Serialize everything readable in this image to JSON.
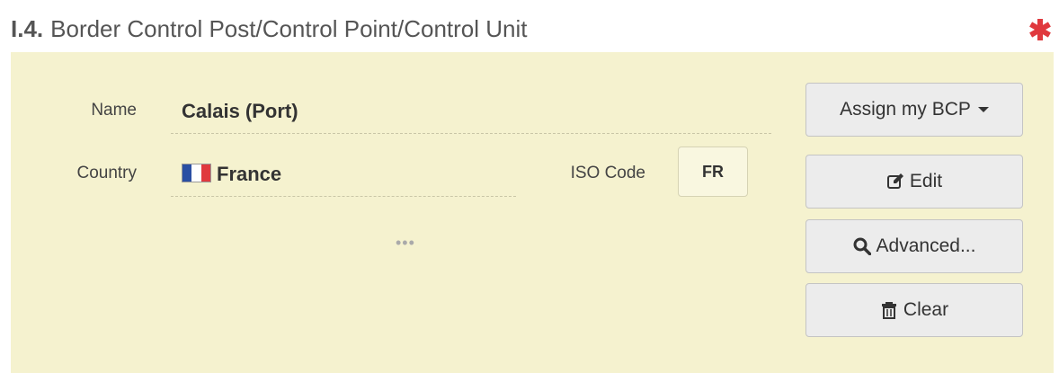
{
  "section": {
    "number": "I.4.",
    "title": "Border Control Post/Control Point/Control Unit",
    "required_icon": "asterisk-icon",
    "required_color": "#e0393e"
  },
  "fields": {
    "name_label": "Name",
    "name_value": "Calais (Port)",
    "country_label": "Country",
    "country_value": "France",
    "country_flag_icon": "flag-france-icon",
    "iso_label": "ISO Code",
    "iso_value": "FR",
    "ellipsis": "•••"
  },
  "buttons": {
    "assign_label": "Assign my BCP",
    "edit_label": "Edit",
    "edit_icon": "edit-icon",
    "advanced_label": "Advanced...",
    "advanced_icon": "search-icon",
    "clear_label": "Clear",
    "clear_icon": "trash-icon"
  },
  "colors": {
    "panel_background": "#f5f2cf",
    "button_background": "#ececec"
  }
}
